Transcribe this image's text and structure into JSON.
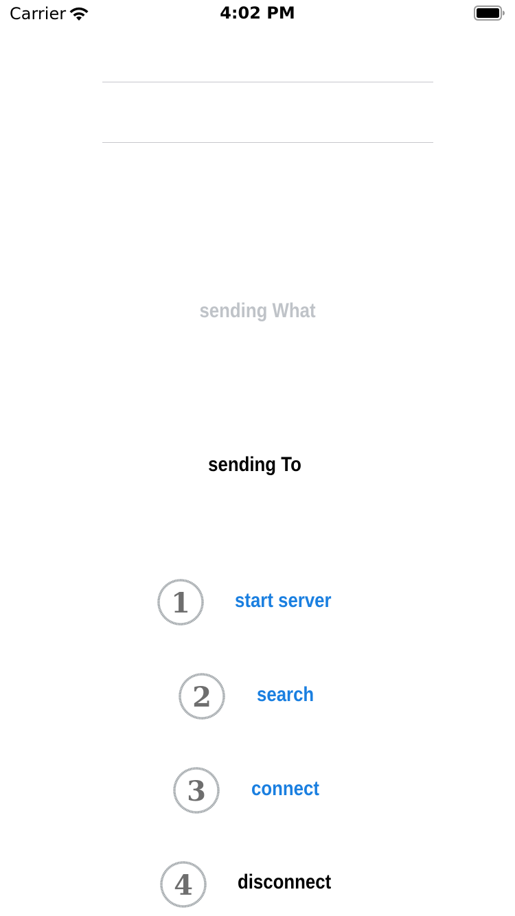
{
  "status_bar": {
    "carrier": "Carrier",
    "time": "4:02 PM",
    "wifi_icon": "wifi-icon",
    "battery_icon": "battery-icon"
  },
  "message_field": {
    "value": "",
    "placeholder": ""
  },
  "labels": {
    "sending_what": "sending What",
    "sending_to": "sending To"
  },
  "steps": [
    {
      "number": "1",
      "label": "start server",
      "color": "#1a7fe0"
    },
    {
      "number": "2",
      "label": "search",
      "color": "#1a7fe0"
    },
    {
      "number": "3",
      "label": "connect",
      "color": "#1a7fe0"
    },
    {
      "number": "4",
      "label": "disconnect",
      "color": "#000000"
    }
  ]
}
